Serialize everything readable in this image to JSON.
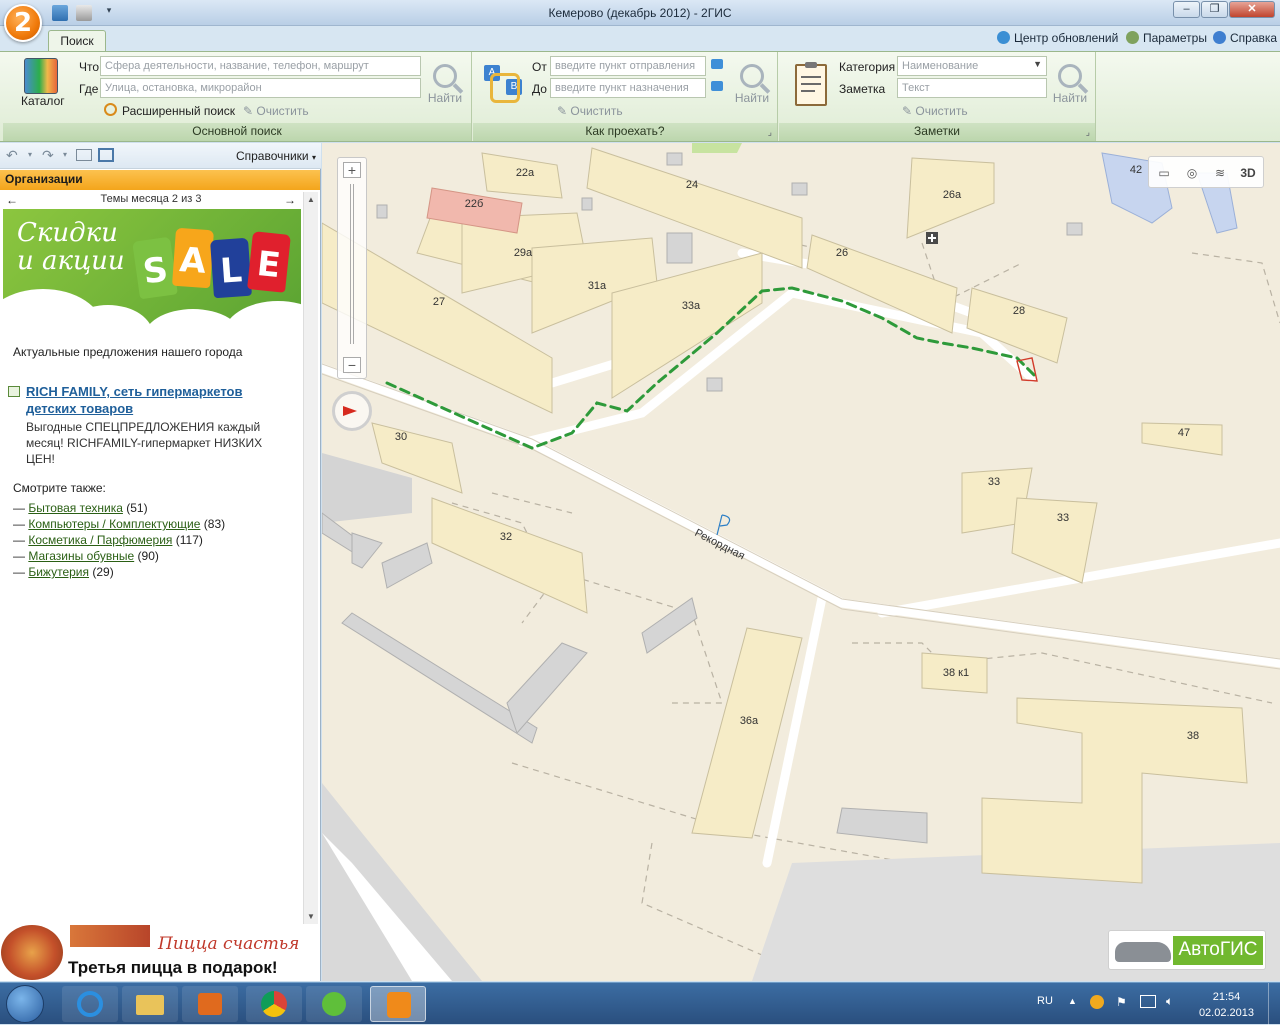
{
  "window": {
    "title": "Кемерово (декабрь 2012) - 2ГИС",
    "logo": "2"
  },
  "tabs": [
    {
      "label": "Поиск"
    }
  ],
  "top_links": {
    "updates": "Центр обновлений",
    "params": "Параметры",
    "help": "Справка"
  },
  "main_search": {
    "catalog_label": "Каталог",
    "what_label": "Что",
    "what_placeholder": "Сфера деятельности, название, телефон, маршрут",
    "where_label": "Где",
    "where_placeholder": "Улица, остановка, микрорайон",
    "advanced": "Расширенный поиск",
    "clear": "Очистить",
    "find": "Найти",
    "group_title": "Основной поиск"
  },
  "route": {
    "from_label": "От",
    "from_placeholder": "введите пункт отправления",
    "to_label": "До",
    "to_placeholder": "введите пункт назначения",
    "clear": "Очистить",
    "find": "Найти",
    "group_title": "Как проехать?"
  },
  "notes": {
    "category_label": "Категория",
    "category_value": "Наименование",
    "note_label": "Заметка",
    "note_placeholder": "Текст",
    "clear": "Очистить",
    "find": "Найти",
    "group_title": "Заметки"
  },
  "left_panel": {
    "directory": "Справочники",
    "org_header": "Организации",
    "month_topics": "Темы месяца 2 из 3",
    "banner_line1": "Скидки",
    "banner_line2": "и акции",
    "banner_sale": [
      "S",
      "A",
      "L",
      "E"
    ],
    "subtitle": "Актуальные предложения нашего города",
    "promo_title": "RICH FAMILY, сеть гипермаркетов детских товаров",
    "promo_title_1": "RICH FAMILY, сеть гипермаркетов",
    "promo_title_2": "детских товаров",
    "promo_text_1": "Выгодные СПЕЦПРЕДЛОЖЕНИЯ каждый",
    "promo_text_2": "месяц! RICHFAMILY-гипермаркет НИЗКИХ",
    "promo_text_3": "ЦЕН!",
    "see_also": "Смотрите также:",
    "links": [
      {
        "label": "Бытовая техника",
        "count": "(51)"
      },
      {
        "label": "Компьютеры / Комплектующие",
        "count": "(83)"
      },
      {
        "label": "Косметика / Парфюмерия",
        "count": "(117)"
      },
      {
        "label": "Магазины обувные",
        "count": "(90)"
      },
      {
        "label": "Бижутерия",
        "count": "(29)"
      }
    ],
    "pizza_title": "Пицца счастья",
    "pizza_offer": "Третья пицца в подарок!"
  },
  "map": {
    "street": "Рекордная",
    "buildings": [
      "22а",
      "24",
      "26а",
      "42",
      "22б",
      "29а",
      "26",
      "31а",
      "27",
      "33а",
      "28",
      "30",
      "47",
      "33",
      "33",
      "32",
      "38 к1",
      "38",
      "36а"
    ],
    "tool_3d": "3D",
    "autogis": "АвтоГИС",
    "route_color": "#2e9a3a"
  },
  "taskbar": {
    "lang": "RU",
    "time": "21:54",
    "date": "02.02.2013"
  }
}
